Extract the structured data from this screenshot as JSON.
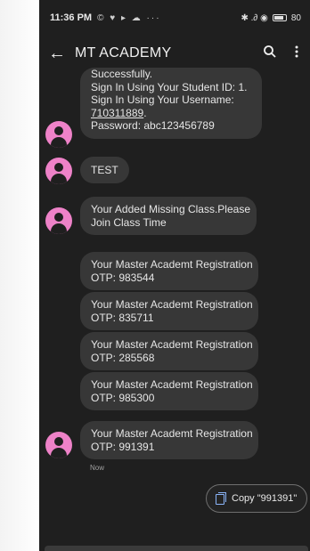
{
  "status_bar": {
    "time": "11:36 PM",
    "left_icons": "© ♥ ▸ ☁ ···",
    "right_icons": "✱ .∂ ◉",
    "battery": "80"
  },
  "app_bar": {
    "title": "MT ACADEMY",
    "back_icon": "arrow-back-icon",
    "search_icon": "search-icon",
    "more_icon": "more-vert-icon"
  },
  "messages": [
    {
      "lines": [
        "Successfully.",
        "Sign In Using Your Student ID: 1.",
        "Sign In Using Your Username:"
      ],
      "link": "710311889",
      "link_suffix": ".",
      "last_line": "Password: abc123456789"
    },
    {
      "text": "TEST"
    },
    {
      "lines": [
        "Your Added Missing Class.Please",
        "Join Class Time"
      ]
    },
    {
      "lines": [
        "Your Master Academt Registration",
        "OTP: 983544"
      ]
    },
    {
      "lines": [
        "Your Master Academt Registration",
        "OTP: 835711"
      ]
    },
    {
      "lines": [
        "Your Master Academt Registration",
        "OTP: 285568"
      ]
    },
    {
      "lines": [
        "Your Master Academt Registration",
        "OTP: 985300"
      ]
    },
    {
      "lines": [
        "Your Master Academt Registration",
        "OTP: 991391"
      ]
    }
  ],
  "timestamp": "Now",
  "copy_chip": {
    "label": "Copy \"991391\"",
    "icon": "copy-icon"
  },
  "colors": {
    "background": "#1f1f1f",
    "bubble": "#373737",
    "avatar": "#ee82c8",
    "accent": "#8ab4f8"
  }
}
